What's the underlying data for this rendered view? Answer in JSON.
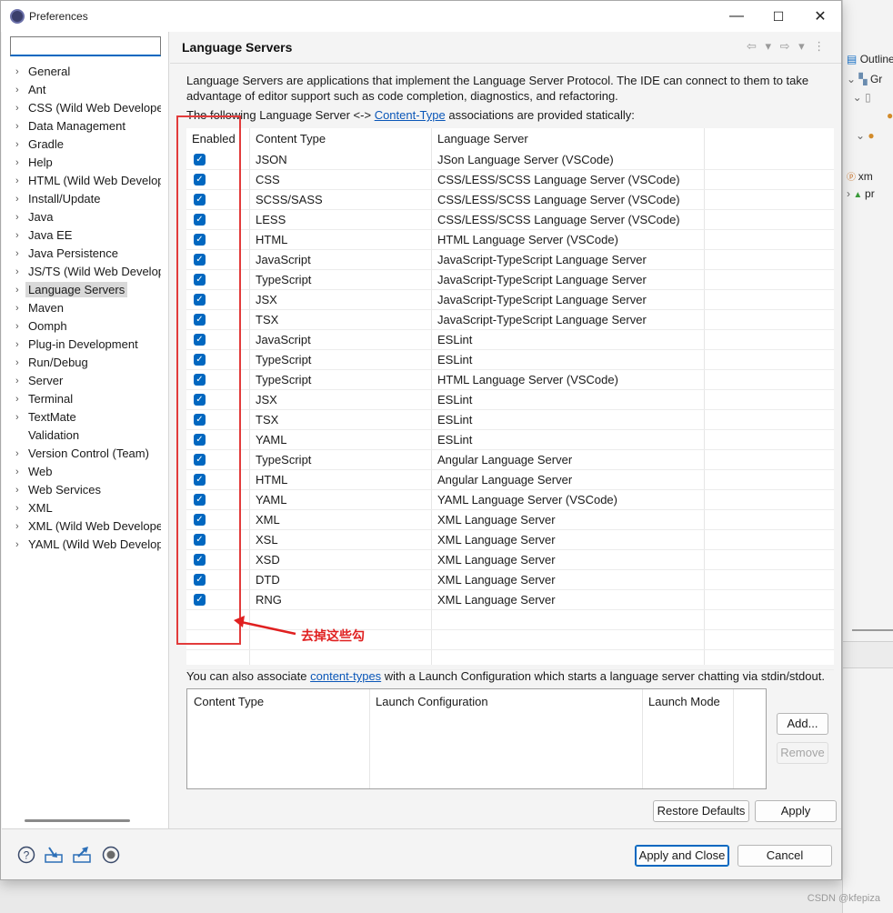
{
  "window": {
    "title": "Preferences",
    "minimize": "—",
    "maximize": "☐",
    "close": "✕"
  },
  "filter": {
    "value": "",
    "placeholder": ""
  },
  "tree": [
    {
      "label": "General",
      "chevron": true
    },
    {
      "label": "Ant",
      "chevron": true
    },
    {
      "label": "CSS (Wild Web Develope",
      "chevron": true
    },
    {
      "label": "Data Management",
      "chevron": true
    },
    {
      "label": "Gradle",
      "chevron": true
    },
    {
      "label": "Help",
      "chevron": true
    },
    {
      "label": "HTML (Wild Web Develop",
      "chevron": true
    },
    {
      "label": "Install/Update",
      "chevron": true
    },
    {
      "label": "Java",
      "chevron": true
    },
    {
      "label": "Java EE",
      "chevron": true
    },
    {
      "label": "Java Persistence",
      "chevron": true
    },
    {
      "label": "JS/TS (Wild Web Develop",
      "chevron": true
    },
    {
      "label": "Language Servers",
      "chevron": true,
      "selected": true
    },
    {
      "label": "Maven",
      "chevron": true
    },
    {
      "label": "Oomph",
      "chevron": true
    },
    {
      "label": "Plug-in Development",
      "chevron": true
    },
    {
      "label": "Run/Debug",
      "chevron": true
    },
    {
      "label": "Server",
      "chevron": true
    },
    {
      "label": "Terminal",
      "chevron": true
    },
    {
      "label": "TextMate",
      "chevron": true
    },
    {
      "label": "Validation",
      "chevron": false
    },
    {
      "label": "Version Control (Team)",
      "chevron": true
    },
    {
      "label": "Web",
      "chevron": true
    },
    {
      "label": "Web Services",
      "chevron": true
    },
    {
      "label": "XML",
      "chevron": true
    },
    {
      "label": "XML (Wild Web Develope",
      "chevron": true
    },
    {
      "label": "YAML (Wild Web Develop",
      "chevron": true
    }
  ],
  "page": {
    "title": "Language Servers",
    "nav": "⇦ ▾ ⇨ ▾ ⋮",
    "description": "Language Servers are applications that implement the Language Server Protocol. The IDE can connect to them to take advantage of editor support such as code completion, diagnostics, and refactoring.",
    "assoc_prefix": "The following Language Server <-> ",
    "assoc_link": "Content-Type",
    "assoc_suffix": " associations are provided statically:"
  },
  "table": {
    "headers": {
      "enabled": "Enabled",
      "content_type": "Content Type",
      "language_server": "Language Server"
    },
    "rows": [
      {
        "enabled": true,
        "content_type": "JSON",
        "server": "JSon Language Server (VSCode)"
      },
      {
        "enabled": true,
        "content_type": "CSS",
        "server": "CSS/LESS/SCSS Language Server (VSCode)"
      },
      {
        "enabled": true,
        "content_type": "SCSS/SASS",
        "server": "CSS/LESS/SCSS Language Server (VSCode)"
      },
      {
        "enabled": true,
        "content_type": "LESS",
        "server": "CSS/LESS/SCSS Language Server (VSCode)"
      },
      {
        "enabled": true,
        "content_type": "HTML",
        "server": "HTML Language Server (VSCode)"
      },
      {
        "enabled": true,
        "content_type": "JavaScript",
        "server": "JavaScript-TypeScript Language Server"
      },
      {
        "enabled": true,
        "content_type": "TypeScript",
        "server": "JavaScript-TypeScript Language Server"
      },
      {
        "enabled": true,
        "content_type": "JSX",
        "server": "JavaScript-TypeScript Language Server"
      },
      {
        "enabled": true,
        "content_type": "TSX",
        "server": "JavaScript-TypeScript Language Server"
      },
      {
        "enabled": true,
        "content_type": "JavaScript",
        "server": "ESLint"
      },
      {
        "enabled": true,
        "content_type": "TypeScript",
        "server": "ESLint"
      },
      {
        "enabled": true,
        "content_type": "TypeScript",
        "server": "HTML Language Server (VSCode)"
      },
      {
        "enabled": true,
        "content_type": "JSX",
        "server": "ESLint"
      },
      {
        "enabled": true,
        "content_type": "TSX",
        "server": "ESLint"
      },
      {
        "enabled": true,
        "content_type": "YAML",
        "server": "ESLint"
      },
      {
        "enabled": true,
        "content_type": "TypeScript",
        "server": "Angular Language Server"
      },
      {
        "enabled": true,
        "content_type": "HTML",
        "server": "Angular Language Server"
      },
      {
        "enabled": true,
        "content_type": "YAML",
        "server": "YAML Language Server (VSCode)"
      },
      {
        "enabled": true,
        "content_type": "XML",
        "server": "XML Language Server"
      },
      {
        "enabled": true,
        "content_type": "XSL",
        "server": "XML Language Server"
      },
      {
        "enabled": true,
        "content_type": "XSD",
        "server": "XML Language Server"
      },
      {
        "enabled": true,
        "content_type": "DTD",
        "server": "XML Language Server"
      },
      {
        "enabled": true,
        "content_type": "RNG",
        "server": "XML Language Server"
      }
    ]
  },
  "annotation": {
    "text": "去掉这些勾",
    "color": "#e02020"
  },
  "launch": {
    "prefix": "You can also associate ",
    "link": "content-types",
    "suffix": " with a Launch Configuration which starts a language server chatting via stdin/stdout.",
    "headers": {
      "content_type": "Content Type",
      "launch_configuration": "Launch Configuration",
      "launch_mode": "Launch Mode"
    },
    "add_label": "Add...",
    "remove_label": "Remove"
  },
  "buttons": {
    "restore_defaults": "Restore Defaults",
    "apply": "Apply",
    "apply_and_close": "Apply and Close",
    "cancel": "Cancel"
  },
  "footer_icons": [
    "help-icon",
    "import-icon",
    "export-icon",
    "record-icon"
  ],
  "background": {
    "outline_label": "Outline",
    "rows": [
      "Gr",
      "xm",
      "pr"
    ]
  },
  "watermark": "CSDN @kfepiza",
  "colors": {
    "accent": "#0067c0",
    "annotation": "#e02020",
    "link": "#0b57b8"
  }
}
